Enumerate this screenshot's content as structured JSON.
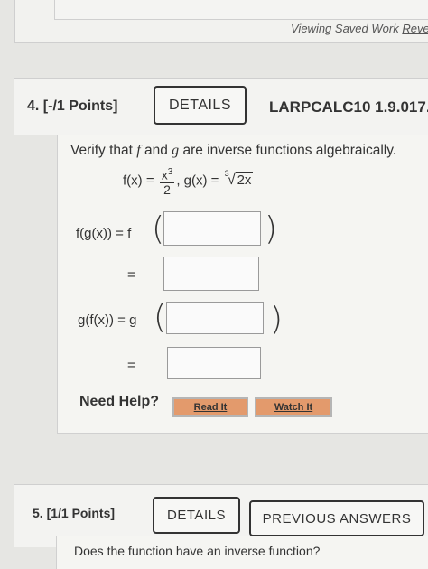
{
  "top": {
    "saved_prefix": "Viewing Saved Work ",
    "saved_link": "Reve"
  },
  "q4": {
    "number": "4.",
    "points": "[-/1 Points]",
    "details_label": "DETAILS",
    "code": "LARPCALC10 1.9.017.",
    "prompt_pre": "Verify that ",
    "prompt_f": "f",
    "prompt_mid": " and ",
    "prompt_g": "g",
    "prompt_post": " are inverse functions algebraically.",
    "f_def_lhs": "f(x) = ",
    "f_num_base": "x",
    "f_num_exp": "3",
    "f_den": "2",
    "g_def_lhs": ",   g(x) = ",
    "g_root_index": "3",
    "g_radicand": "2x",
    "fg_label": "f(g(x)) = f",
    "eq_sign": "=",
    "gf_label": "g(f(x)) = g",
    "open_paren": "(",
    "close_paren": ")",
    "need_help": "Need Help?",
    "read_it": "Read It",
    "watch_it": "Watch It",
    "answers": {
      "fg_inner": "",
      "fg_result": "",
      "gf_inner": "",
      "gf_result": ""
    }
  },
  "q5": {
    "number": "5.",
    "points": "[1/1 Points]",
    "details_label": "DETAILS",
    "prev_answers_label": "PREVIOUS ANSWERS",
    "prompt": "Does the function have an inverse function?"
  }
}
